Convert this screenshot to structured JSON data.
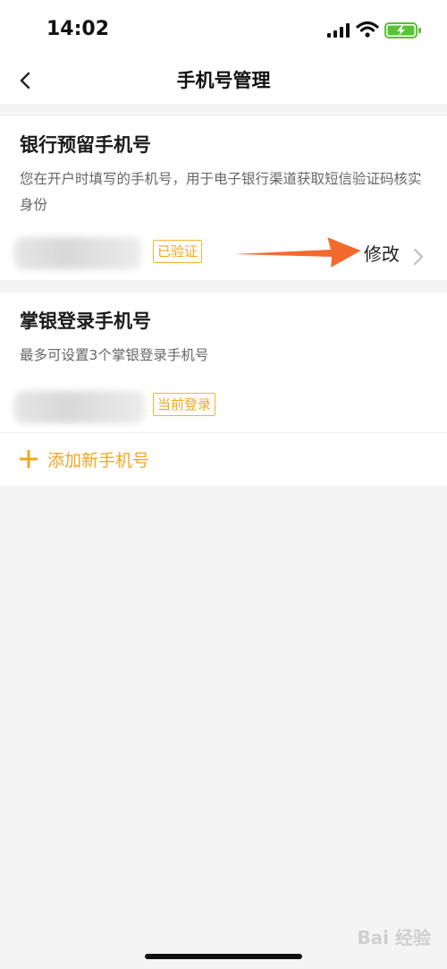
{
  "status_bar": {
    "time": "14:02",
    "icons": [
      "signal-icon",
      "wifi-icon",
      "battery-charging-icon"
    ]
  },
  "nav": {
    "back_icon": "chevron-left-icon",
    "title": "手机号管理"
  },
  "bank_section": {
    "title": "银行预留手机号",
    "description": "您在开户时填写的手机号，用于电子银行渠道获取短信验证码核实身份",
    "badge": "已验证",
    "edit_label": "修改",
    "edit_icon": "chevron-right-icon"
  },
  "login_section": {
    "title": "掌银登录手机号",
    "description": "最多可设置3个掌银登录手机号",
    "badge": "当前登录",
    "add_label": "添加新手机号",
    "add_icon": "plus-icon"
  },
  "watermark": "Bai 经验",
  "colors": {
    "accent": "#f0a820",
    "annotation_arrow": "#f26a2e",
    "background": "#f4f4f4"
  }
}
